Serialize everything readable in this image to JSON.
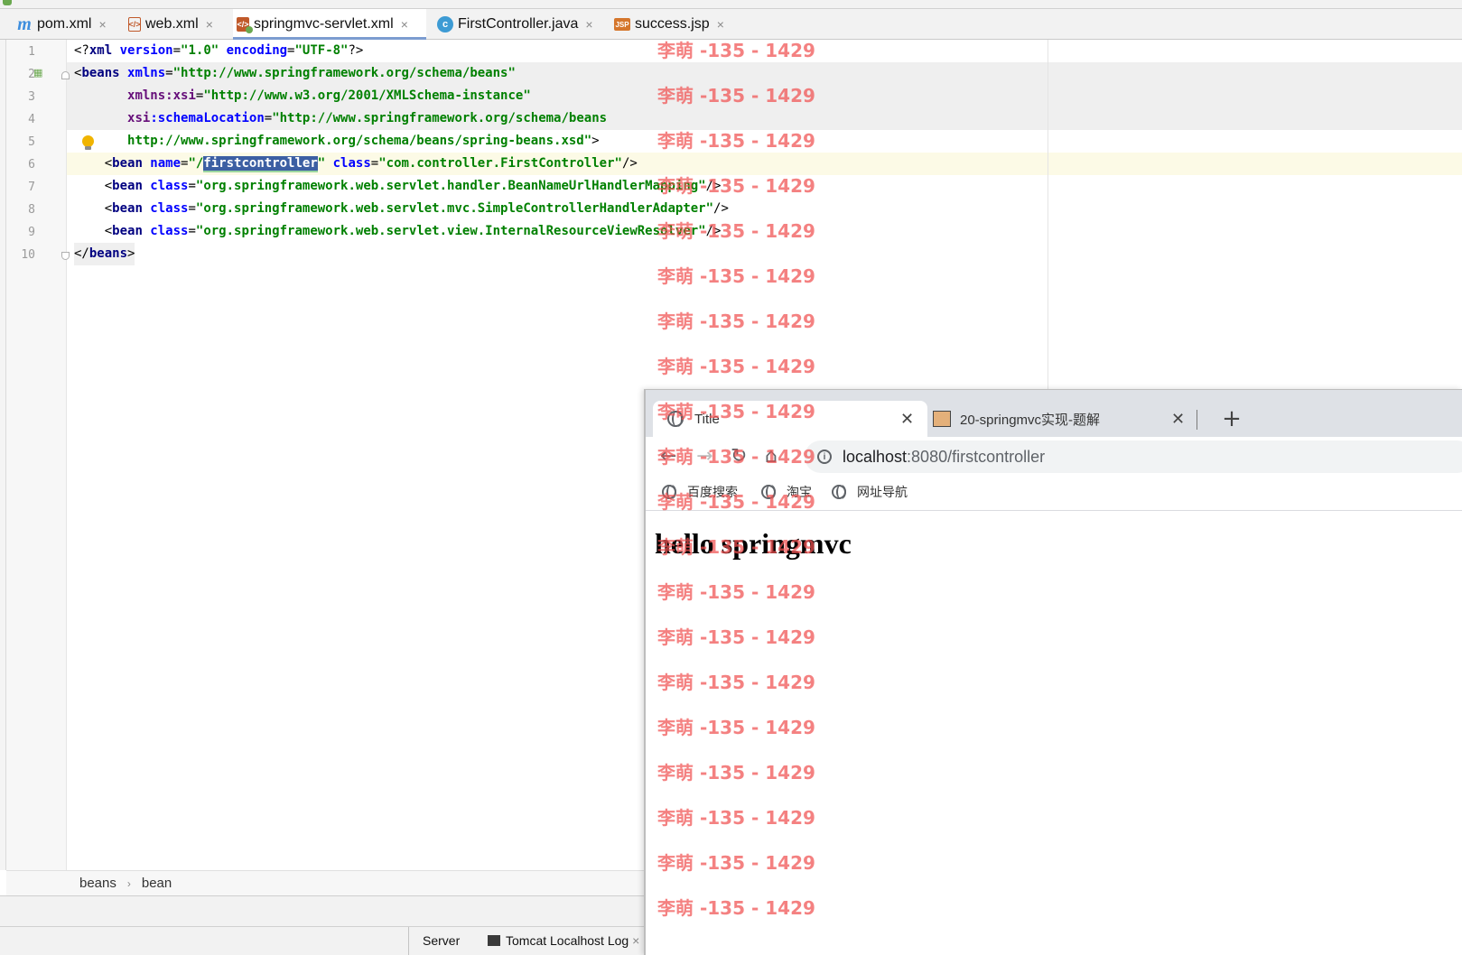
{
  "ide": {
    "tabs": [
      {
        "label": "pom.xml",
        "icon": "maven-icon",
        "active": false
      },
      {
        "label": "web.xml",
        "icon": "xml-file-icon",
        "active": false
      },
      {
        "label": "springmvc-servlet.xml",
        "icon": "spring-xml-icon",
        "active": true
      },
      {
        "label": "FirstController.java",
        "icon": "java-class-icon",
        "active": false
      },
      {
        "label": "success.jsp",
        "icon": "jsp-file-icon",
        "active": false
      }
    ],
    "line_numbers": [
      "1",
      "2",
      "3",
      "4",
      "5",
      "6",
      "7",
      "8",
      "9",
      "10"
    ],
    "code": {
      "l1": {
        "a": "<?",
        "b": "xml",
        "c": " version",
        "d": "=",
        "e": "\"1.0\"",
        "f": " encoding",
        "g": "=",
        "h": "\"UTF-8\"",
        "i": "?>"
      },
      "l2": {
        "a": "<",
        "b": "beans",
        "c": " xmlns",
        "d": "=",
        "e": "\"http://www.springframework.org/schema/beans\""
      },
      "l3": {
        "a": "       ",
        "b": "xmlns:xsi",
        "c": "=",
        "d": "\"http://www.w3.org/2001/XMLSchema-instance\""
      },
      "l4": {
        "a": "       ",
        "b": "xsi",
        "c": ":schemaLocation",
        "d": "=",
        "e": "\"http://www.springframework.org/schema/beans"
      },
      "l5": {
        "a": "       ",
        "b": "http://www.springframework.org/schema/beans/spring-beans.xsd\"",
        "c": ">"
      },
      "l6": {
        "a": "    <",
        "b": "bean",
        "c": " name",
        "d": "=",
        "e": "\"/",
        "f": "firstcontroller",
        "g": "\"",
        "h": " class",
        "i": "=",
        "j": "\"com.controller.FirstController\"",
        "k": "/>"
      },
      "l7": {
        "a": "    <",
        "b": "bean",
        "c": " class",
        "d": "=",
        "e": "\"org.springframework.web.servlet.handler.BeanNameUrlHandlerMapping\"",
        "f": "/>"
      },
      "l8": {
        "a": "    <",
        "b": "bean",
        "c": " class",
        "d": "=",
        "e": "\"org.springframework.web.servlet.mvc.SimpleControllerHandlerAdapter\"",
        "f": "/>"
      },
      "l9": {
        "a": "    <",
        "b": "bean",
        "c": " class",
        "d": "=",
        "e": "\"org.springframework.web.servlet.view.InternalResourceViewResolver\"",
        "f": "/>"
      },
      "l10": {
        "a": "</",
        "b": "beans",
        "c": ">"
      }
    },
    "breadcrumb": {
      "first": "beans",
      "sep": "›",
      "second": "bean"
    },
    "bottom_tabs": {
      "server": "Server",
      "tomcat": "Tomcat Localhost Log",
      "tomcat_close": "×"
    },
    "close_glyph": "×"
  },
  "browser": {
    "tabs": [
      {
        "label": "Title",
        "icon": "globe-icon",
        "active": true
      },
      {
        "label": "20-springmvc实现-题解",
        "icon": "site-favicon-icon",
        "active": false
      }
    ],
    "close_glyph": "✕",
    "new_tab_glyph": "+",
    "nav": {
      "back": "←",
      "forward": "→",
      "reload": "↻",
      "home": "⌂"
    },
    "address": {
      "info": "i",
      "host": "localhost",
      "path": ":8080/firstcontroller"
    },
    "bookmarks": [
      "百度搜索",
      "淘宝",
      "网址导航"
    ],
    "page": {
      "heading": "hello springmvc"
    }
  },
  "watermark": {
    "text": "李萌 -135 - 1429",
    "color": "#f05050"
  }
}
